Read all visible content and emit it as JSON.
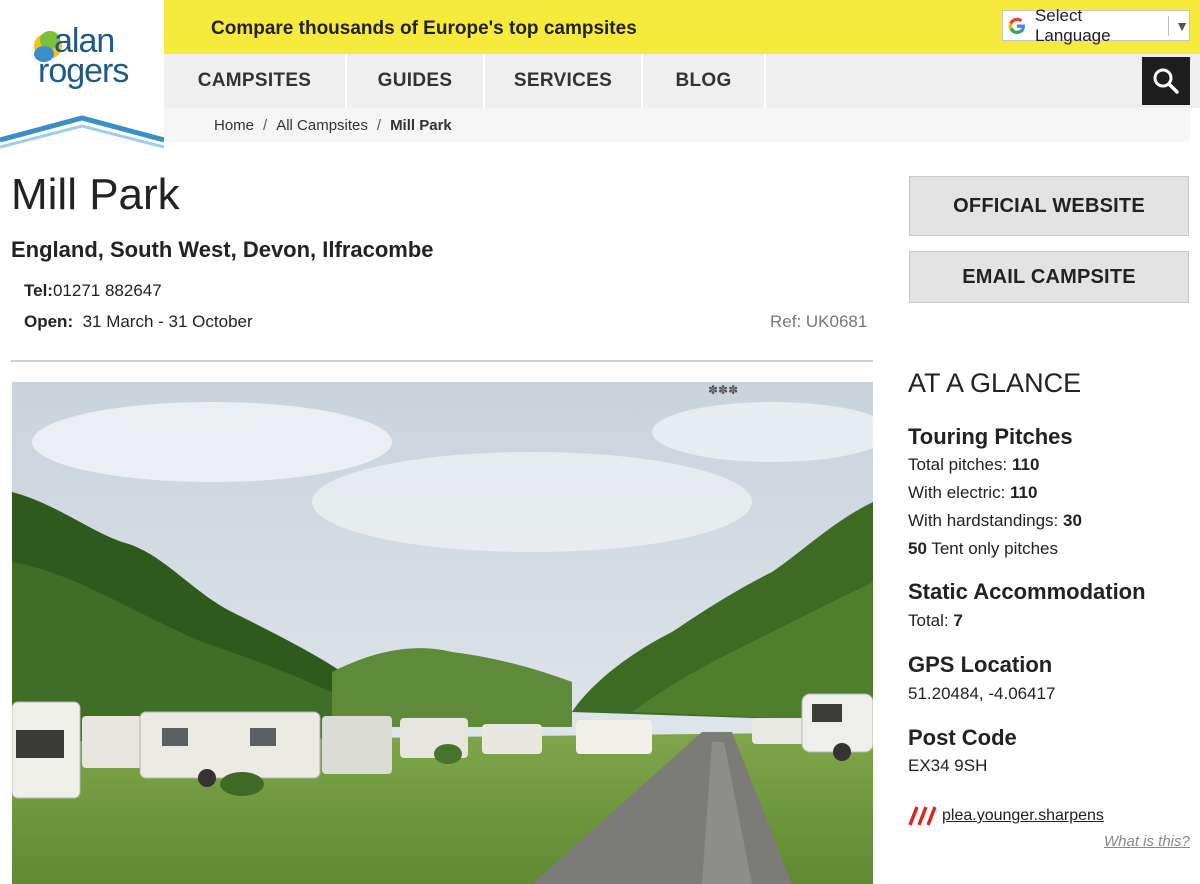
{
  "logo": {
    "line1": "alan",
    "line2": "rogers"
  },
  "top_bar": {
    "tagline": "Compare thousands of Europe's top campsites"
  },
  "language": {
    "label": "Select Language",
    "arrow": "▼"
  },
  "nav": {
    "items": [
      "CAMPSITES",
      "GUIDES",
      "SERVICES",
      "BLOG"
    ]
  },
  "breadcrumb": {
    "home": "Home",
    "all": "All Campsites",
    "current": "Mill Park",
    "separator": "/"
  },
  "campsite": {
    "name": "Mill Park",
    "location": "England, South West, Devon, Ilfracombe",
    "tel_label": "Tel:",
    "tel_value": "01271 882647",
    "open_label": "Open:",
    "open_value": "31 March - 31 October",
    "ref": "Ref: UK0681"
  },
  "buttons": {
    "official_website": "OFFICIAL WEBSITE",
    "email_campsite": "EMAIL CAMPSITE"
  },
  "glance": {
    "title": "AT A GLANCE",
    "touring": {
      "heading": "Touring Pitches",
      "total_label": "Total pitches:",
      "total_value": "110",
      "electric_label": "With electric:",
      "electric_value": "110",
      "hard_label": "With hardstandings:",
      "hard_value": "30",
      "tent_value": "50",
      "tent_label": "Tent only pitches"
    },
    "static": {
      "heading": "Static Accommodation",
      "total_label": "Total:",
      "total_value": "7"
    },
    "gps": {
      "heading": "GPS Location",
      "value": "51.20484, -4.06417"
    },
    "postcode": {
      "heading": "Post Code",
      "value": "EX34 9SH"
    }
  },
  "ad": {
    "link": "plea.younger.sharpens",
    "what": "What is this?"
  },
  "colors": {
    "yellow": "#f6ea3c",
    "logo_blue": "#1f5a86",
    "accent_blue": "#3a8fc8",
    "ad_red": "#e2231a"
  }
}
